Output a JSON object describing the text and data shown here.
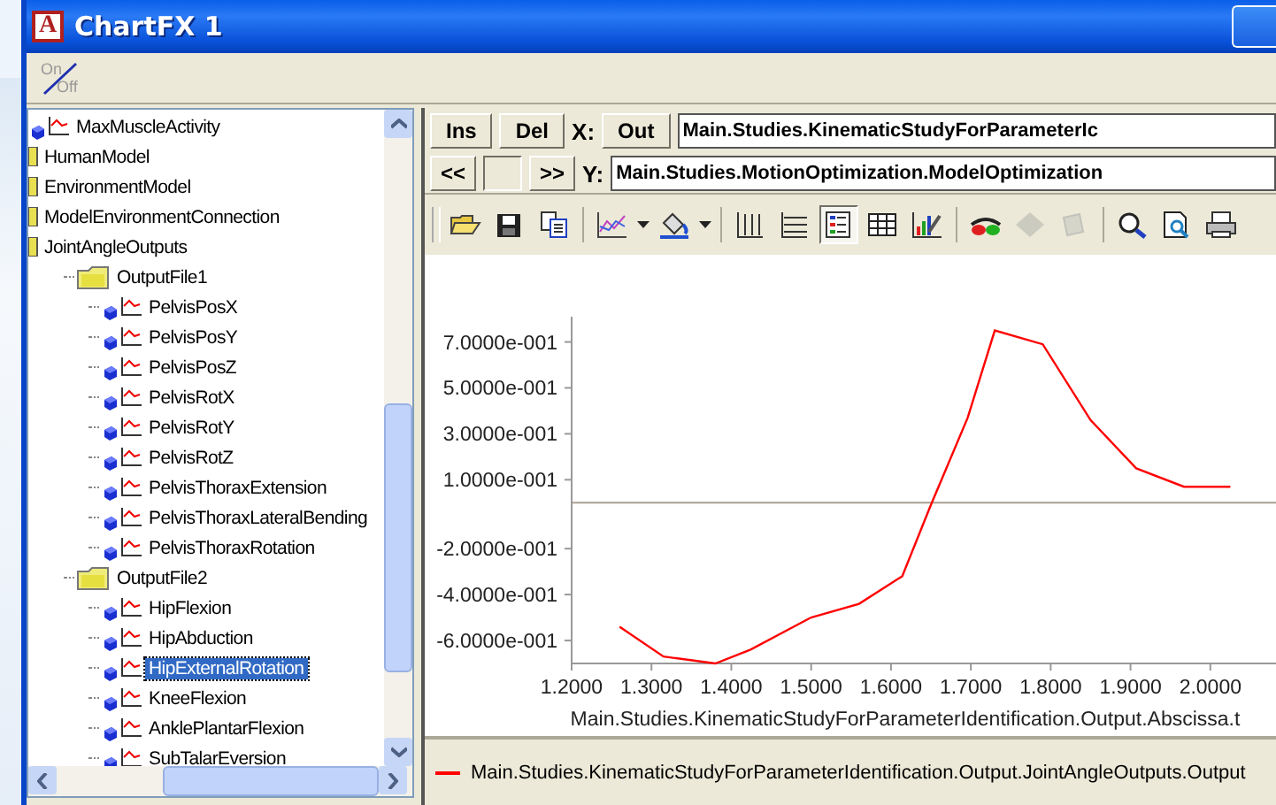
{
  "window": {
    "title": "ChartFX 1",
    "icon_letter": "A"
  },
  "toolbar": {
    "on_label": "On",
    "off_label": "Off"
  },
  "tree": [
    {
      "label": "MaxMuscleActivity",
      "kind": "series",
      "selected": false
    },
    {
      "label": "HumanModel",
      "kind": "folder",
      "selected": false
    },
    {
      "label": "EnvironmentModel",
      "kind": "folder",
      "selected": false
    },
    {
      "label": "ModelEnvironmentConnection",
      "kind": "folder",
      "selected": false
    },
    {
      "label": "JointAngleOutputs",
      "kind": "folder",
      "selected": false,
      "children": [
        {
          "label": "OutputFile1",
          "kind": "folder",
          "selected": false,
          "children": [
            {
              "label": "PelvisPosX",
              "kind": "series",
              "selected": false
            },
            {
              "label": "PelvisPosY",
              "kind": "series",
              "selected": false
            },
            {
              "label": "PelvisPosZ",
              "kind": "series",
              "selected": false
            },
            {
              "label": "PelvisRotX",
              "kind": "series",
              "selected": false
            },
            {
              "label": "PelvisRotY",
              "kind": "series",
              "selected": false
            },
            {
              "label": "PelvisRotZ",
              "kind": "series",
              "selected": false
            },
            {
              "label": "PelvisThoraxExtension",
              "kind": "series",
              "selected": false
            },
            {
              "label": "PelvisThoraxLateralBending",
              "kind": "series",
              "selected": false
            },
            {
              "label": "PelvisThoraxRotation",
              "kind": "series",
              "selected": false
            }
          ]
        },
        {
          "label": "OutputFile2",
          "kind": "folder",
          "selected": false,
          "children": [
            {
              "label": "HipFlexion",
              "kind": "series",
              "selected": false
            },
            {
              "label": "HipAbduction",
              "kind": "series",
              "selected": false
            },
            {
              "label": "HipExternalRotation",
              "kind": "series",
              "selected": true
            },
            {
              "label": "KneeFlexion",
              "kind": "series",
              "selected": false
            },
            {
              "label": "AnklePlantarFlexion",
              "kind": "series",
              "selected": false
            },
            {
              "label": "SubTalarEversion",
              "kind": "series",
              "selected": false
            }
          ]
        }
      ]
    }
  ],
  "controls": {
    "ins": "Ins",
    "del": "Del",
    "x_label": "X:",
    "out": "Out",
    "x_value": "Main.Studies.KinematicStudyForParameterIc",
    "prev": "<<",
    "next": ">>",
    "y_label": "Y:",
    "y_value": "Main.Studies.MotionOptimization.ModelOptimization"
  },
  "chart_toolbar": [
    {
      "kind": "open",
      "pressed": false,
      "disabled": false
    },
    {
      "kind": "save",
      "pressed": false,
      "disabled": false
    },
    {
      "kind": "copy",
      "pressed": false,
      "disabled": false
    },
    {
      "kind": "sep"
    },
    {
      "kind": "gallery",
      "pressed": false,
      "disabled": false
    },
    {
      "kind": "dropdown"
    },
    {
      "kind": "color",
      "pressed": false,
      "disabled": false
    },
    {
      "kind": "dropdown"
    },
    {
      "kind": "sep"
    },
    {
      "kind": "vgrid",
      "pressed": false,
      "disabled": false
    },
    {
      "kind": "hgrid",
      "pressed": false,
      "disabled": false
    },
    {
      "kind": "legend",
      "pressed": true,
      "disabled": false
    },
    {
      "kind": "table",
      "pressed": false,
      "disabled": false
    },
    {
      "kind": "tools",
      "pressed": false,
      "disabled": false
    },
    {
      "kind": "sep"
    },
    {
      "kind": "glasses",
      "pressed": false,
      "disabled": false
    },
    {
      "kind": "diamond",
      "pressed": false,
      "disabled": true
    },
    {
      "kind": "properties",
      "pressed": false,
      "disabled": true
    },
    {
      "kind": "sep"
    },
    {
      "kind": "zoom",
      "pressed": false,
      "disabled": false
    },
    {
      "kind": "preview",
      "pressed": false,
      "disabled": false
    },
    {
      "kind": "print",
      "pressed": false,
      "disabled": false
    }
  ],
  "chart": {
    "chart_data": {
      "type": "line",
      "xlabel": "Main.Studies.KinematicStudyForParameterIdentification.Output.Abscissa.t",
      "xlim": [
        1.2,
        2.08
      ],
      "ylim": [
        -0.7,
        0.81
      ],
      "xticks": [
        {
          "value": 1.2,
          "label": "1.2000"
        },
        {
          "value": 1.3,
          "label": "1.3000"
        },
        {
          "value": 1.4,
          "label": "1.4000"
        },
        {
          "value": 1.5,
          "label": "1.5000"
        },
        {
          "value": 1.6,
          "label": "1.6000"
        },
        {
          "value": 1.7,
          "label": "1.7000"
        },
        {
          "value": 1.8,
          "label": "1.8000"
        },
        {
          "value": 1.9,
          "label": "1.9000"
        },
        {
          "value": 2.0,
          "label": "2.0000"
        }
      ],
      "yticks": [
        {
          "value": 0.7,
          "label": "7.0000e-001"
        },
        {
          "value": 0.5,
          "label": "5.0000e-001"
        },
        {
          "value": 0.3,
          "label": "3.0000e-001"
        },
        {
          "value": 0.1,
          "label": "1.0000e-001"
        },
        {
          "value": -0.2,
          "label": "-2.0000e-001"
        },
        {
          "value": -0.4,
          "label": "-4.0000e-001"
        },
        {
          "value": -0.6,
          "label": "-6.0000e-001"
        }
      ],
      "x": [
        1.26,
        1.315,
        1.38,
        1.424,
        1.5,
        1.56,
        1.614,
        1.65,
        1.696,
        1.73,
        1.79,
        1.85,
        1.907,
        1.967,
        2.025
      ],
      "series": [
        {
          "name": "Main.Studies.KinematicStudyForParameterIdentification.Output.JointAngleOutputs.Output",
          "color": "#ff0000",
          "values": [
            -0.54,
            -0.67,
            -0.7,
            -0.64,
            -0.5,
            -0.44,
            -0.32,
            -0.01,
            0.37,
            0.75,
            0.69,
            0.36,
            0.15,
            0.07,
            0.07
          ]
        }
      ]
    }
  }
}
